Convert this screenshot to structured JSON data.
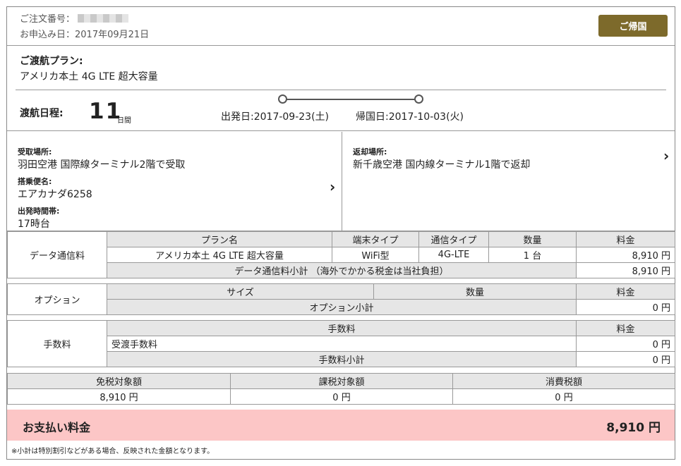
{
  "header": {
    "order_label": "ご注文番号：",
    "applied_label": "お申込み日：",
    "applied_date": "2017年09月21日",
    "return_button": "ご帰国"
  },
  "plan": {
    "title": "ご渡航プラン:",
    "name": "アメリカ本土 4G LTE 超大容量"
  },
  "schedule": {
    "label": "渡航日程:",
    "days": "11",
    "days_unit": "日間",
    "departure": "出発日:2017-09-23(土)",
    "return": "帰国日:2017-10-03(火)"
  },
  "pickup": {
    "place_label": "受取場所:",
    "place": "羽田空港 国際線ターミナル2階で受取",
    "flight_label": "搭乗便名:",
    "flight": "エアカナダ6258",
    "time_label": "出発時間帯:",
    "time": "17時台"
  },
  "dropoff": {
    "place_label": "返却場所:",
    "place": "新千歳空港 国内線ターミナル1階で返却"
  },
  "data_fee": {
    "section": "データ通信料",
    "headers": [
      "プラン名",
      "端末タイプ",
      "通信タイプ",
      "数量",
      "料金"
    ],
    "row": [
      "アメリカ本土 4G LTE 超大容量",
      "WiFi型",
      "4G-LTE",
      "1 台",
      "8,910 円"
    ],
    "subtotal_label": "データ通信料小計 （海外でかかる税金は当社負担）",
    "subtotal": "8,910 円"
  },
  "option": {
    "section": "オプション",
    "headers": [
      "サイズ",
      "数量",
      "料金"
    ],
    "subtotal_label": "オプション小計",
    "subtotal": "0 円"
  },
  "commission": {
    "section": "手数料",
    "headers": [
      "手数料",
      "料金"
    ],
    "row": [
      "受渡手数料",
      "0 円"
    ],
    "subtotal_label": "手数料小計",
    "subtotal": "0 円"
  },
  "tax": {
    "headers": [
      "免税対象額",
      "課税対象額",
      "消費税額"
    ],
    "values": [
      "8,910 円",
      "0 円",
      "0 円"
    ]
  },
  "total": {
    "label": "お支払い料金",
    "amount": "8,910 円"
  },
  "note": "※小計は特別割引などがある場合、反映された金額となります。"
}
